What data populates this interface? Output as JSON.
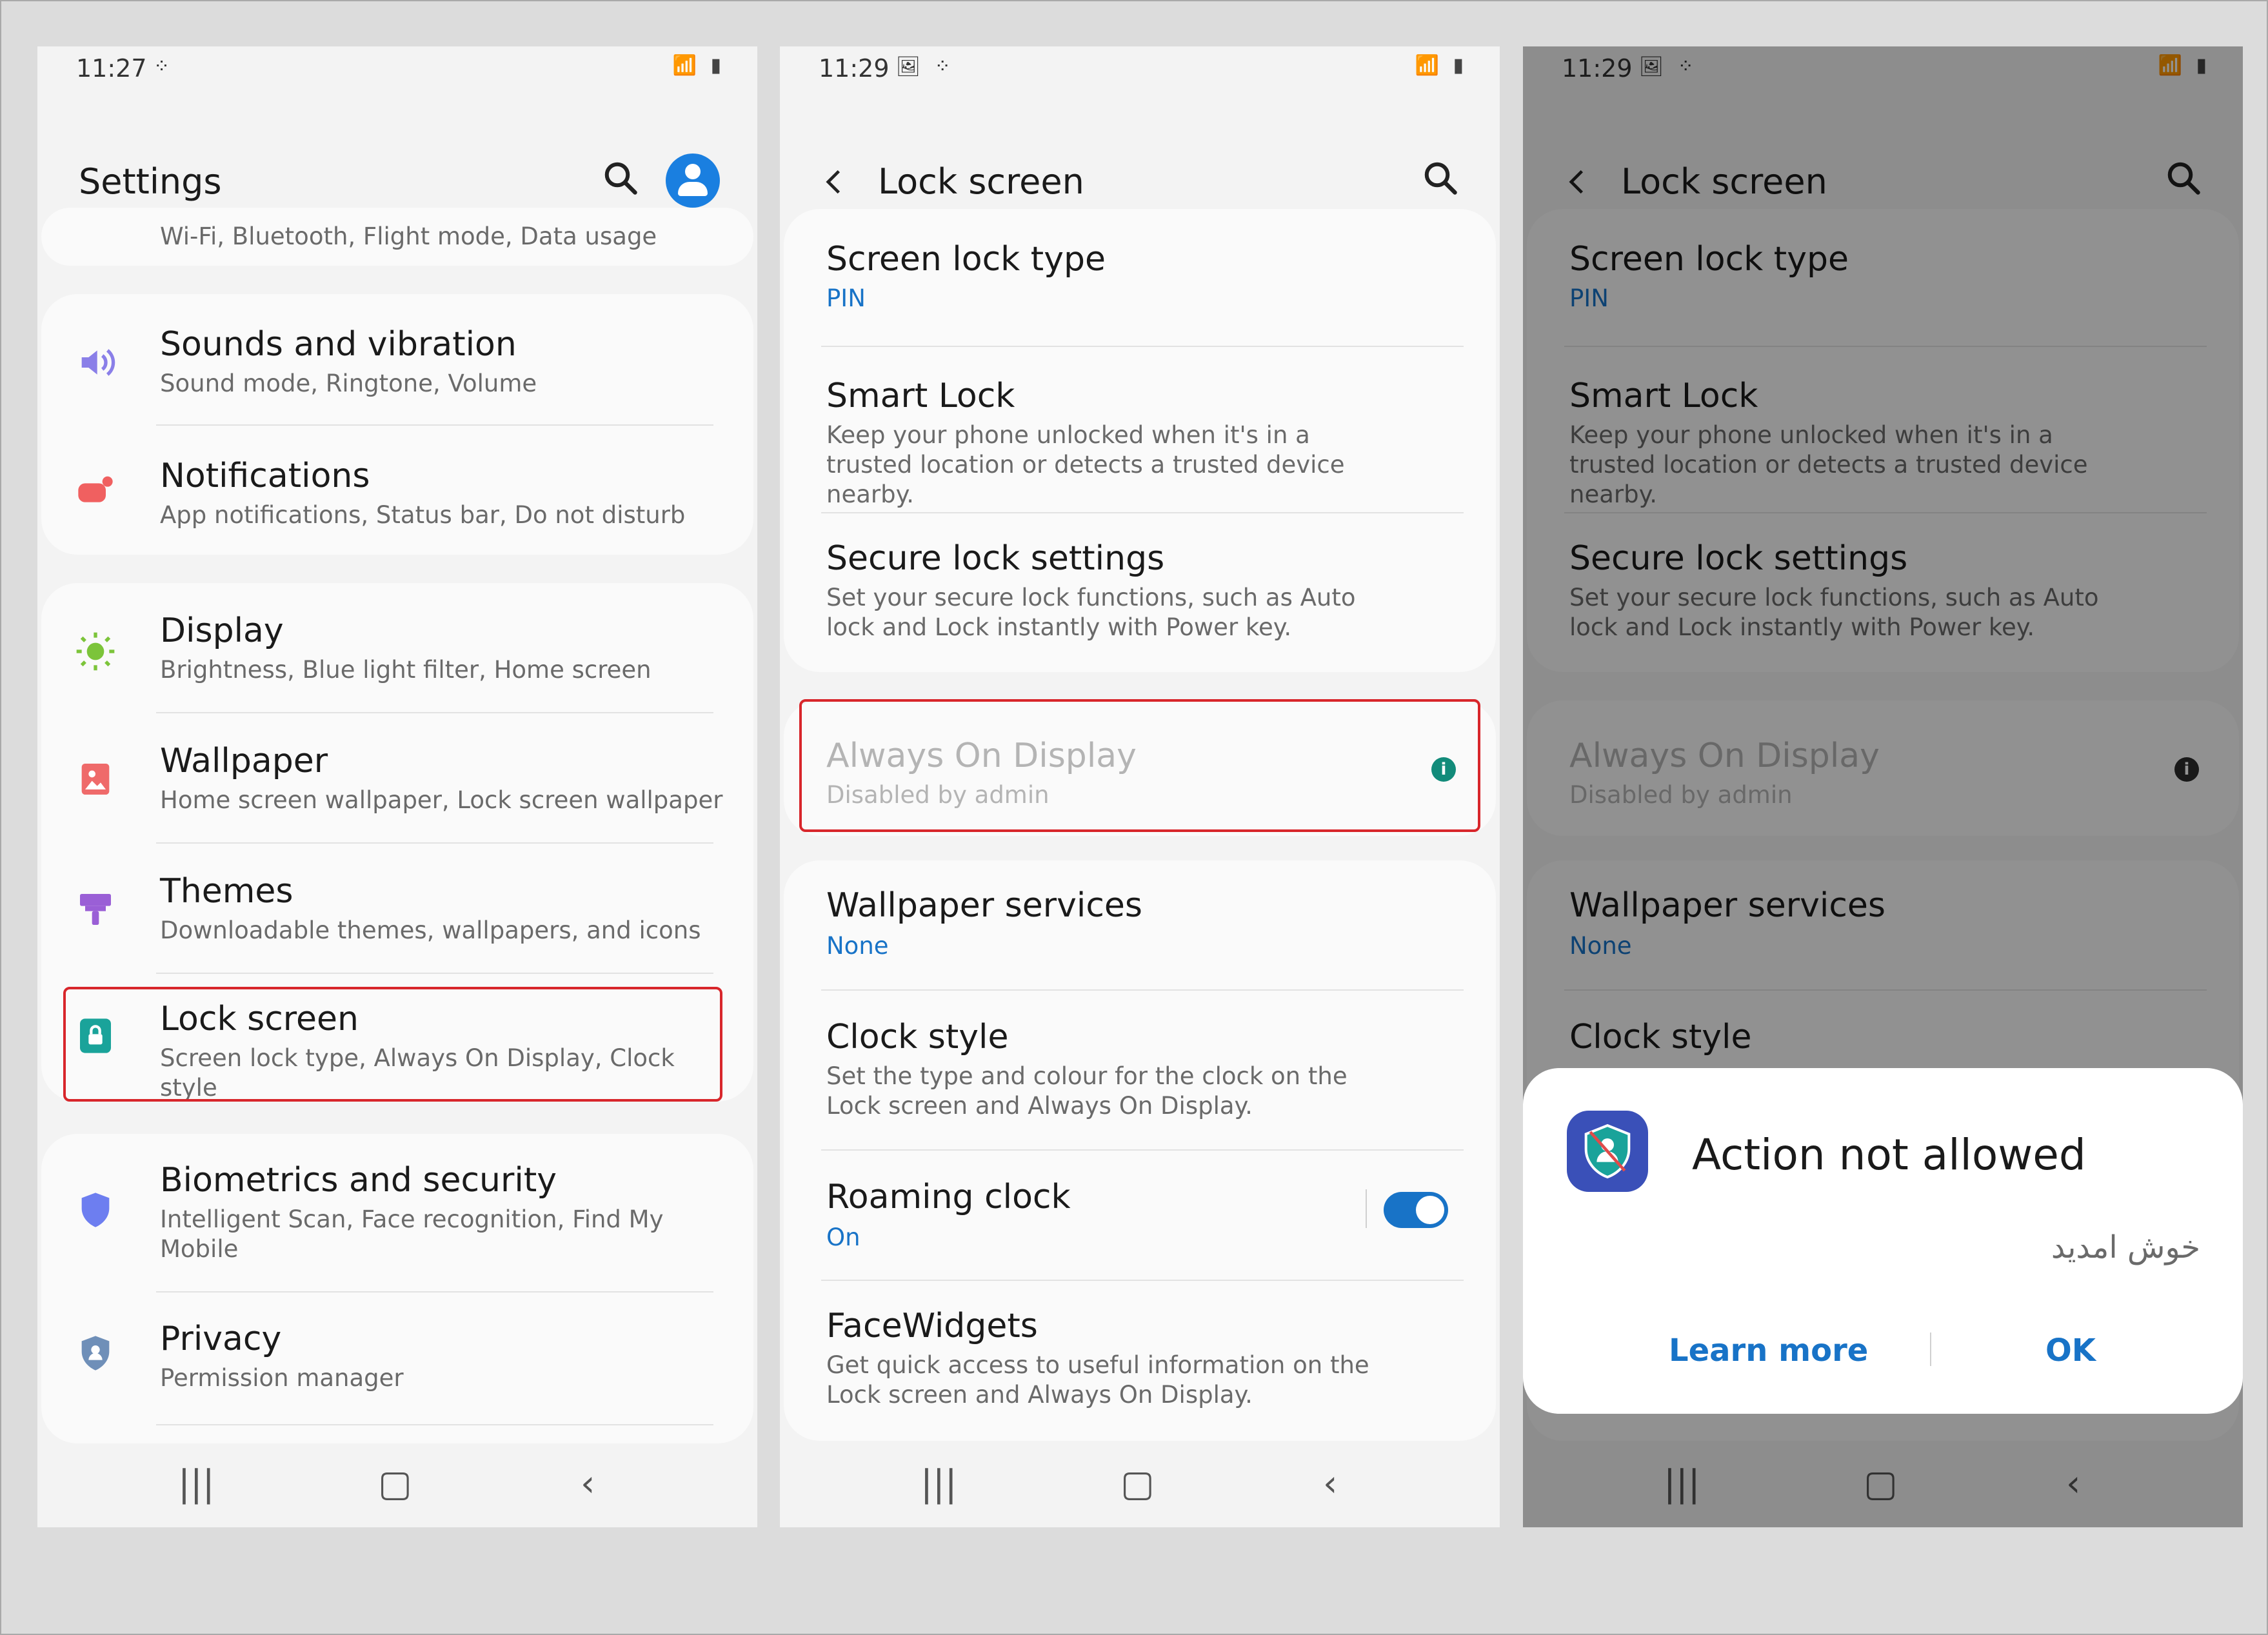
{
  "colors": {
    "accent": "#1873c7",
    "highlight": "#d8262b",
    "background": "#f3f3f3"
  },
  "status_bar": {
    "p1": {
      "time": "11:27",
      "left_icons": "⁘",
      "right_icons": "📶 ▮"
    },
    "p2": {
      "time": "11:29",
      "left_icons": "🖼 ⁘",
      "right_icons": "📶 ▮"
    },
    "p3": {
      "time": "11:29",
      "left_icons": "🖼 ⁘",
      "right_icons": "📶 ▮"
    }
  },
  "settings_screen": {
    "title": "Settings",
    "top_partial_sub": "Wi-Fi, Bluetooth, Flight mode, Data usage",
    "items": [
      {
        "icon": "speaker-icon",
        "title": "Sounds and vibration",
        "sub": "Sound mode, Ringtone, Volume"
      },
      {
        "icon": "notification-icon",
        "title": "Notifications",
        "sub": "App notifications, Status bar, Do not disturb"
      },
      {
        "icon": "brightness-icon",
        "title": "Display",
        "sub": "Brightness, Blue light filter, Home screen"
      },
      {
        "icon": "wallpaper-icon",
        "title": "Wallpaper",
        "sub": "Home screen wallpaper, Lock screen wallpaper"
      },
      {
        "icon": "brush-icon",
        "title": "Themes",
        "sub": "Downloadable themes, wallpapers, and icons"
      },
      {
        "icon": "lock-icon",
        "title": "Lock screen",
        "sub": "Screen lock type, Always On Display, Clock style"
      },
      {
        "icon": "shield-icon",
        "title": "Biometrics and security",
        "sub": "Intelligent Scan, Face recognition, Find My Mobile"
      },
      {
        "icon": "privacy-shield-icon",
        "title": "Privacy",
        "sub": "Permission manager"
      }
    ]
  },
  "lock_screen": {
    "title": "Lock screen",
    "items": [
      {
        "title": "Screen lock type",
        "sub": "PIN"
      },
      {
        "title": "Smart Lock",
        "sub": "Keep your phone unlocked when it's in a trusted location or detects a trusted device nearby."
      },
      {
        "title": "Secure lock settings",
        "sub": "Set your secure lock functions, such as Auto lock and Lock instantly with Power key."
      },
      {
        "title": "Always On Display",
        "sub": "Disabled by admin"
      },
      {
        "title": "Wallpaper services",
        "sub": "None"
      },
      {
        "title": "Clock style",
        "sub": "Set the type and colour for the clock on the Lock screen and Always On Display."
      },
      {
        "title": "Roaming clock",
        "sub": "On",
        "toggle_on": true
      },
      {
        "title": "FaceWidgets",
        "sub": "Get quick access to useful information on the Lock screen and Always On Display."
      }
    ]
  },
  "dialog": {
    "title": "Action not allowed",
    "message": "خوش امدید",
    "learn_more": "Learn more",
    "ok": "OK"
  },
  "navbar": {
    "recents": "|||",
    "home": "▢",
    "back": "‹"
  }
}
